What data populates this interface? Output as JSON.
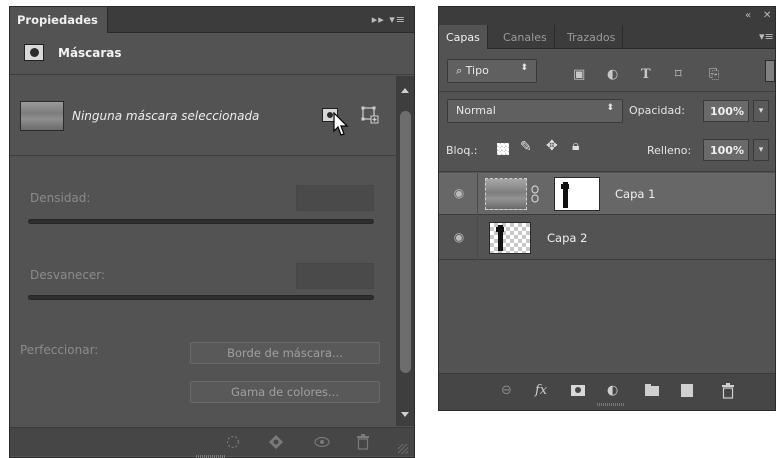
{
  "properties": {
    "tab_label": "Propiedades",
    "panel_menu_glyphs": "▸▸ ▾≡",
    "section_title": "Máscaras",
    "mask_status": "Ninguna máscara seleccionada",
    "density_label": "Densidad:",
    "feather_label": "Desvanecer:",
    "refine_label": "Perfeccionar:",
    "mask_edge_button": "Borde de máscara...",
    "color_range_button": "Gama de colores..."
  },
  "layers": {
    "tabs": [
      "Capas",
      "Canales",
      "Trazados"
    ],
    "filter_kind": "Tipo",
    "blend_mode": "Normal",
    "opacity_label": "Opacidad:",
    "opacity_value": "100%",
    "lock_label": "Bloq.:",
    "fill_label": "Relleno:",
    "fill_value": "100%",
    "items": [
      {
        "name": "Capa 1",
        "selected": true
      },
      {
        "name": "Capa 2",
        "selected": false
      }
    ]
  },
  "icons": {
    "collapse": "«",
    "close": "✕",
    "eye": "◉",
    "fx": "fx"
  },
  "colors": {
    "panel_bg": "#535353",
    "header_bg": "#3c3c3c",
    "selected_row": "#676767"
  }
}
